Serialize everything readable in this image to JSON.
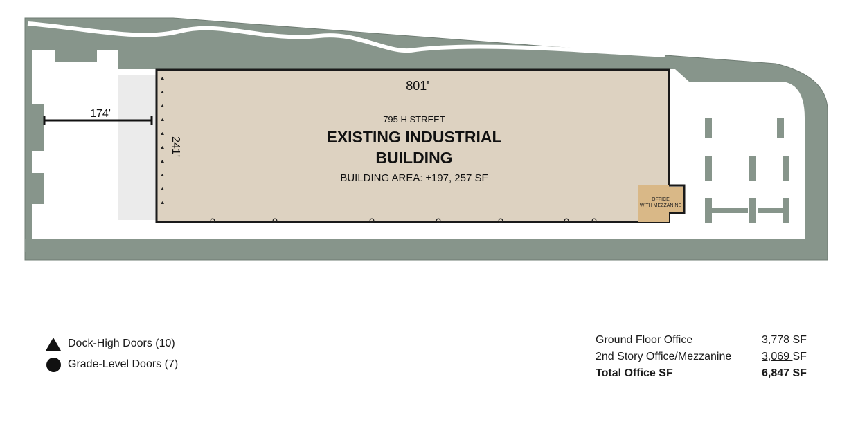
{
  "site_plan": {
    "dimension_length": "801'",
    "dimension_depth": "241'",
    "dimension_truck_court": "174'",
    "address": "795 H STREET",
    "building_title_line1": "EXISTING INDUSTRIAL",
    "building_title_line2": "BUILDING",
    "building_area": "BUILDING AREA: ±197, 257 SF",
    "office_label_line1": "OFFICE",
    "office_label_line2": "WITH MEZZANINE",
    "colors": {
      "landscape": "#87958b",
      "building": "#ddd2c1",
      "office": "#d9b887",
      "paving": "#ffffff",
      "outline": "#1a1a1a"
    }
  },
  "legend": {
    "items": [
      {
        "symbol": "triangle-icon",
        "label": "Dock-High Doors (10)"
      },
      {
        "symbol": "circle-icon",
        "label": "Grade-Level Doors (7)"
      }
    ]
  },
  "office_summary": {
    "rows": [
      {
        "label": "Ground Floor Office",
        "value": "3,778 SF"
      },
      {
        "label": "2nd Story Office/Mezzanine",
        "value_main": "3,069 ",
        "value_unit": "SF"
      },
      {
        "label": "Total Office SF",
        "value": "6,847 SF"
      }
    ]
  }
}
